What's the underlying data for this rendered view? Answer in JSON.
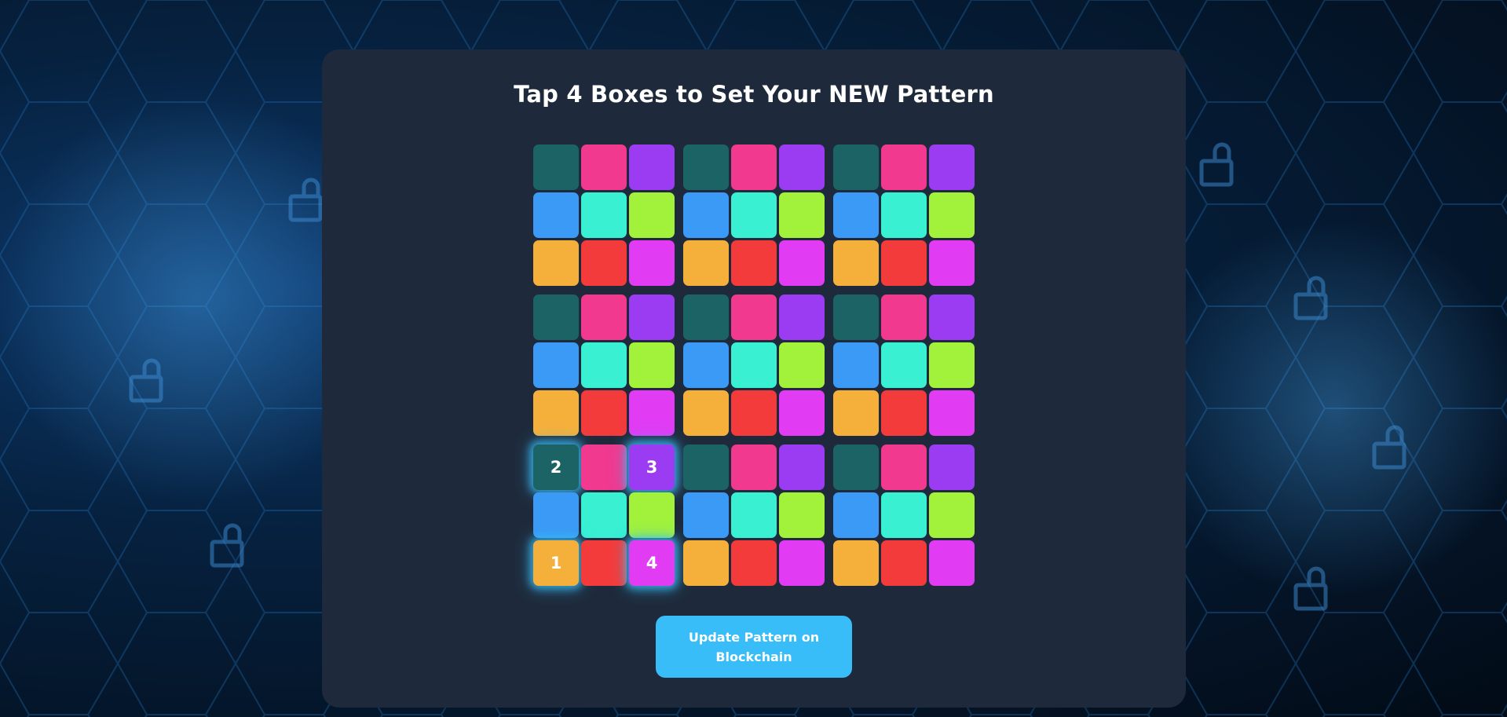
{
  "title": "Tap 4 Boxes to Set Your NEW Pattern",
  "colors": {
    "teal": "#1b6364",
    "pink": "#f0398f",
    "purple": "#9b3bf2",
    "blue": "#3b9af5",
    "cyan": "#39f0d3",
    "lime": "#a2f23b",
    "orange": "#f5b03b",
    "red": "#f43b3b",
    "magenta": "#e13bf4",
    "accent": "#38bdf8",
    "panel": "#1e2a3b"
  },
  "cell_color_pattern": [
    "teal",
    "pink",
    "purple",
    "blue",
    "cyan",
    "lime",
    "orange",
    "red",
    "magenta"
  ],
  "selections": [
    {
      "order": "1",
      "block_row": 2,
      "block_col": 0,
      "cell": 6
    },
    {
      "order": "2",
      "block_row": 2,
      "block_col": 0,
      "cell": 0
    },
    {
      "order": "3",
      "block_row": 2,
      "block_col": 0,
      "cell": 2
    },
    {
      "order": "4",
      "block_row": 2,
      "block_col": 0,
      "cell": 8
    }
  ],
  "update_button_label": "Update Pattern on Blockchain"
}
